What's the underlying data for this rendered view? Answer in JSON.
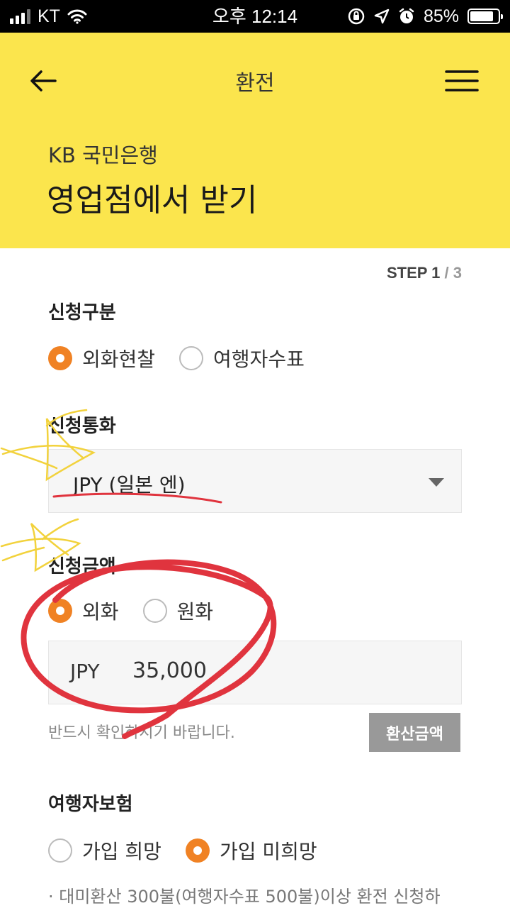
{
  "status_bar": {
    "carrier": "KT",
    "time": "오후 12:14",
    "battery": "85%",
    "battery_level": 0.85,
    "icons": [
      "signal-icon",
      "wifi-icon",
      "orientation-lock-icon",
      "location-icon",
      "alarm-icon",
      "battery-icon"
    ]
  },
  "header": {
    "title": "환전",
    "bank": "KB 국민은행",
    "page_title": "영업점에서 받기",
    "background": "#fbe54d",
    "icons": {
      "back": "back-arrow-icon",
      "menu": "hamburger-menu-icon"
    }
  },
  "step": {
    "label": "STEP 1",
    "separator": " / ",
    "total": "3"
  },
  "application_type": {
    "label": "신청구분",
    "options": [
      {
        "label": "외화현찰",
        "checked": true
      },
      {
        "label": "여행자수표",
        "checked": false
      }
    ]
  },
  "currency": {
    "label": "신청통화",
    "selected": "JPY (일본 엔)"
  },
  "amount": {
    "label": "신청금액",
    "options": [
      {
        "label": "외화",
        "checked": true
      },
      {
        "label": "원화",
        "checked": false
      }
    ],
    "currency_code": "JPY",
    "value": "35,000",
    "hint": "반드시 확인하시기 바랍니다.",
    "convert_button": "환산금액"
  },
  "insurance": {
    "label": "여행자보험",
    "options": [
      {
        "label": "가입 희망",
        "checked": false
      },
      {
        "label": "가입 미희망",
        "checked": true
      }
    ],
    "note": "· 대미환산 300불(여행자수표 500불)이상 환전 신청하"
  },
  "colors": {
    "accent": "#f08224",
    "header_yellow": "#fbe54d",
    "button_gray": "#999999",
    "annotation_red": "#e0343e",
    "annotation_yellow": "#f2d23c"
  }
}
